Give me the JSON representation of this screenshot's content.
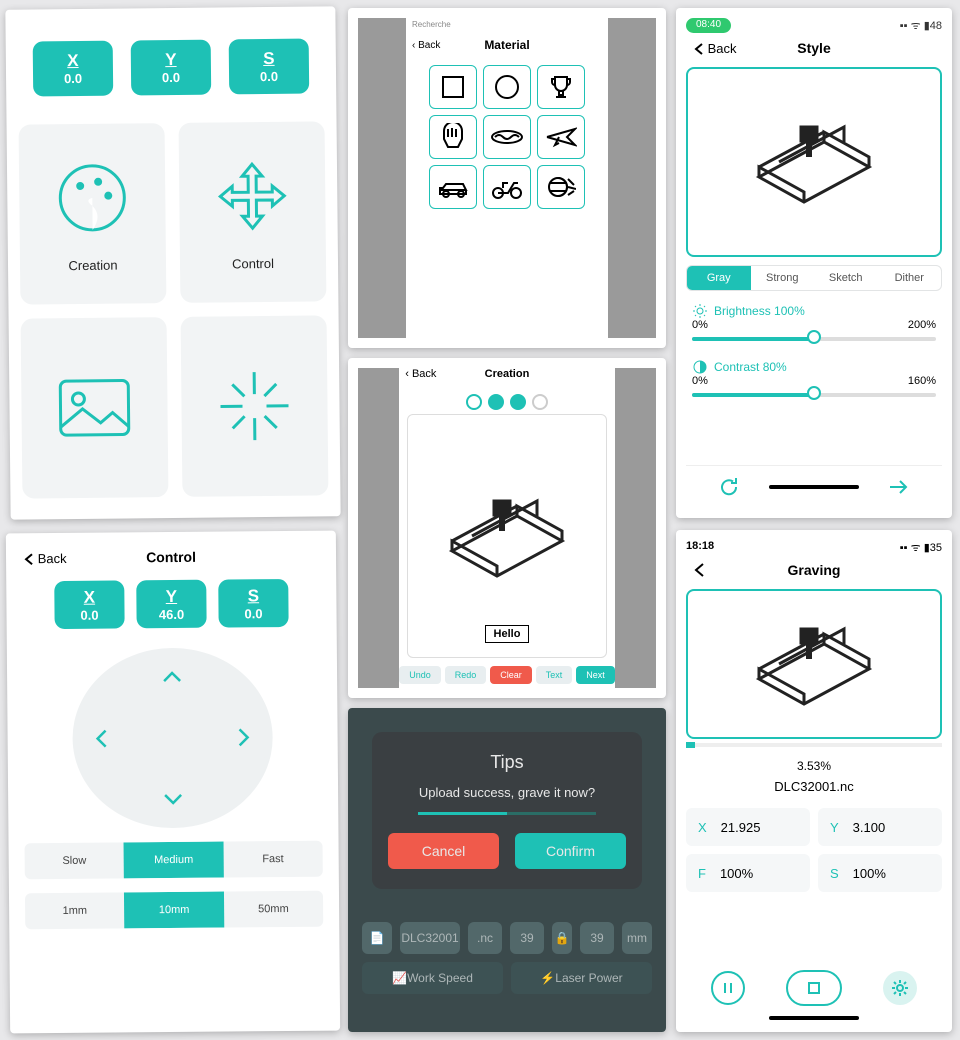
{
  "home": {
    "x": {
      "label": "X",
      "value": "0.0"
    },
    "y": {
      "label": "Y",
      "value": "0.0"
    },
    "s": {
      "label": "S",
      "value": "0.0"
    },
    "tiles": {
      "creation": "Creation",
      "control": "Control"
    }
  },
  "control": {
    "back": "Back",
    "title": "Control",
    "x": {
      "label": "X",
      "value": "0.0"
    },
    "y": {
      "label": "Y",
      "value": "46.0"
    },
    "s": {
      "label": "S",
      "value": "0.0"
    },
    "speed": {
      "slow": "Slow",
      "medium": "Medium",
      "fast": "Fast"
    },
    "step": {
      "a": "1mm",
      "b": "10mm",
      "c": "50mm"
    }
  },
  "material": {
    "back": "Back",
    "title": "Material",
    "top": "Recherche"
  },
  "creation": {
    "back": "Back",
    "title": "Creation",
    "text": "Hello",
    "undo": "Undo",
    "redo": "Redo",
    "clear": "Clear",
    "txt": "Text",
    "next": "Next"
  },
  "tips": {
    "title": "Tips",
    "msg": "Upload success, grave it now?",
    "cancel": "Cancel",
    "confirm": "Confirm",
    "file": "DLC32001",
    "ext": ".nc",
    "n1": "39",
    "n2": "39",
    "unit": "mm",
    "ws": "Work Speed",
    "lp": "Laser Power"
  },
  "style": {
    "time": "08:40",
    "batt": "48",
    "back": "Back",
    "title": "Style",
    "tabs": {
      "gray": "Gray",
      "strong": "Strong",
      "sketch": "Sketch",
      "dither": "Dither"
    },
    "brightness": {
      "label": "Brightness",
      "val": "100%",
      "min": "0%",
      "max": "200%"
    },
    "contrast": {
      "label": "Contrast",
      "val": "80%",
      "min": "0%",
      "max": "160%"
    }
  },
  "graving": {
    "time": "18:18",
    "batt": "35",
    "title": "Graving",
    "progress": "3.53%",
    "file": "DLC32001.nc",
    "x": {
      "l": "X",
      "v": "21.925"
    },
    "y": {
      "l": "Y",
      "v": "3.100"
    },
    "f": {
      "l": "F",
      "v": "100%"
    },
    "s": {
      "l": "S",
      "v": "100%"
    }
  }
}
